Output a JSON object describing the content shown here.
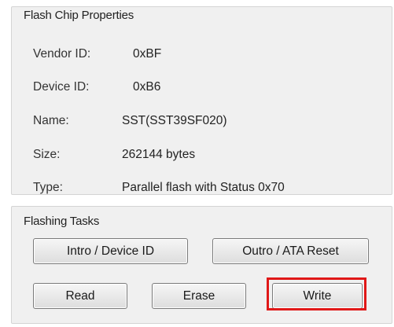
{
  "flash_chip_properties": {
    "title": "Flash Chip Properties",
    "fields": {
      "vendor_id": {
        "label": "Vendor ID:",
        "value": "0xBF"
      },
      "device_id": {
        "label": "Device ID:",
        "value": "0xB6"
      },
      "name": {
        "label": "Name:",
        "value": "SST(SST39SF020)"
      },
      "size": {
        "label": "Size:",
        "value": "262144 bytes"
      },
      "type": {
        "label": "Type:",
        "value": "Parallel flash with Status 0x70"
      }
    }
  },
  "flashing_tasks": {
    "title": "Flashing Tasks",
    "buttons": {
      "intro": "Intro / Device ID",
      "outro": "Outro / ATA Reset",
      "read": "Read",
      "erase": "Erase",
      "write": "Write"
    },
    "highlighted_button": "write",
    "highlight_color": "#e01818"
  }
}
